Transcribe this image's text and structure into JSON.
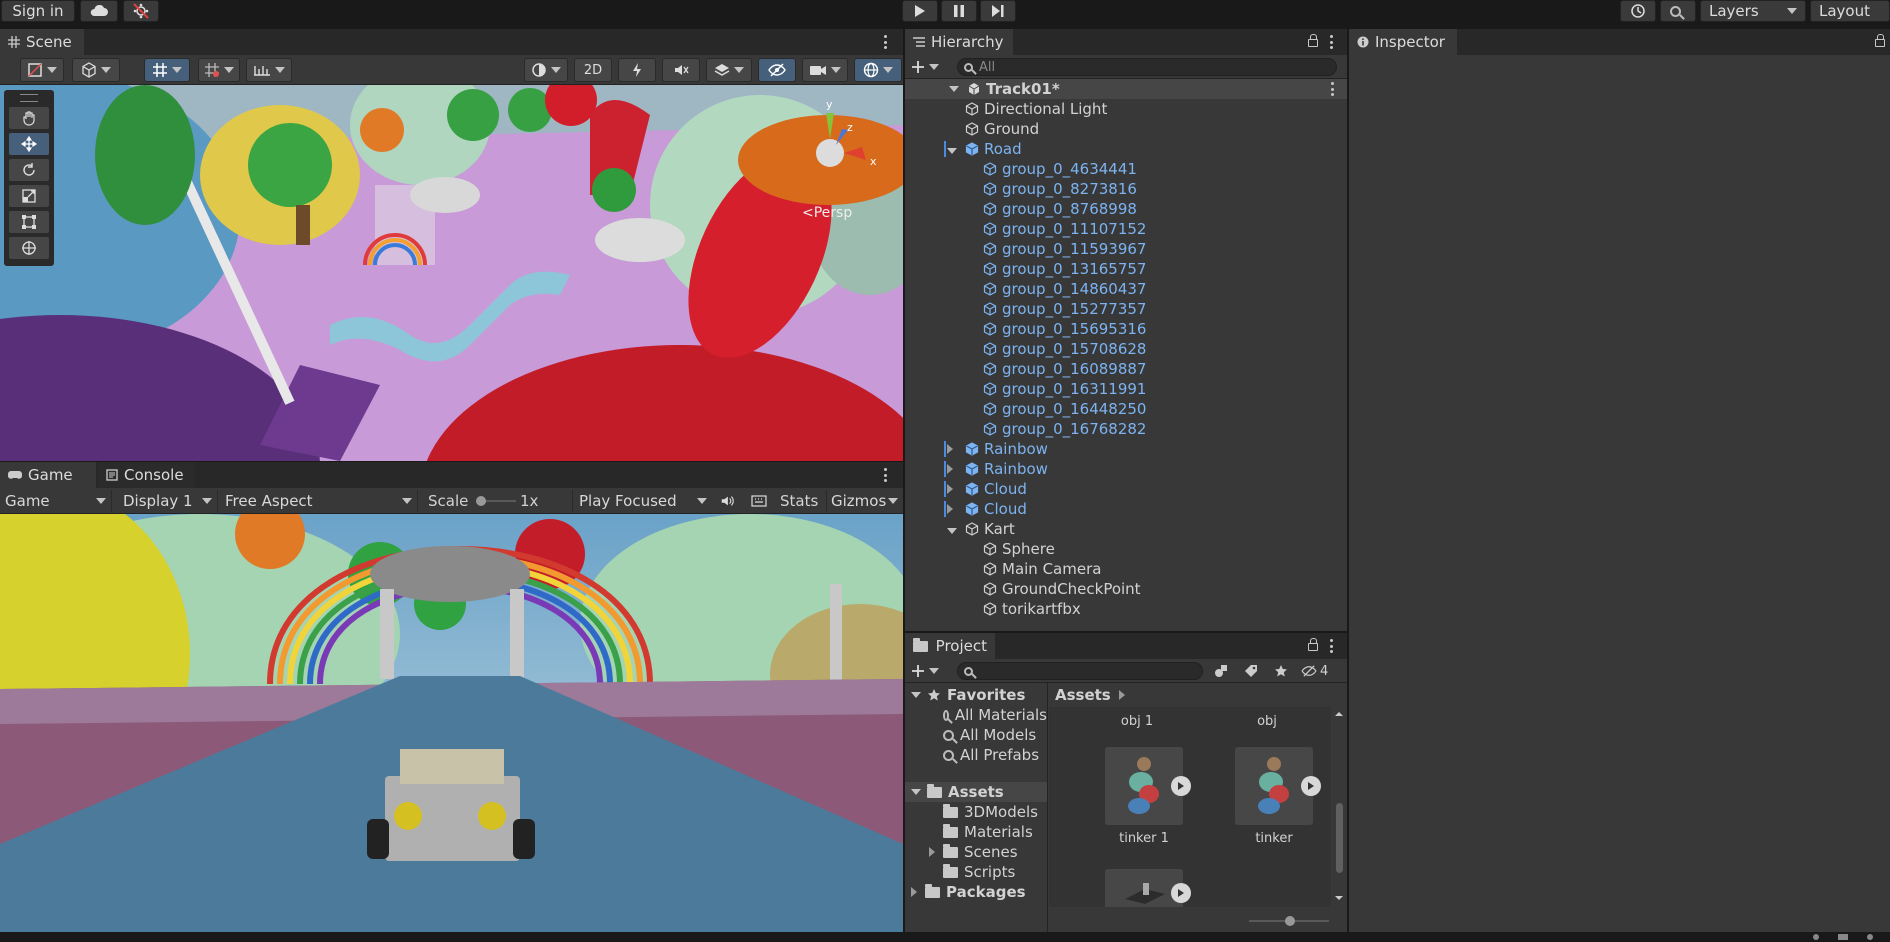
{
  "topbar": {
    "sign_in": "Sign in",
    "layers": "Layers",
    "layout": "Layout"
  },
  "scene": {
    "tab": "Scene",
    "mode_2d": "2D",
    "persp": "Persp",
    "gizmo_y": "y",
    "gizmo_z": "z",
    "gizmo_x": "x"
  },
  "game": {
    "tab_game": "Game",
    "tab_console": "Console",
    "view_select": "Game",
    "display": "Display 1",
    "aspect": "Free Aspect",
    "scale_label": "Scale",
    "scale_value": "1x",
    "play_mode": "Play Focused",
    "stats": "Stats",
    "gizmos": "Gizmos",
    "slider_value": 0
  },
  "hierarchy": {
    "tab": "Hierarchy",
    "search_placeholder": "All",
    "scene_name": "Track01*",
    "items": [
      {
        "label": "Directional Light"
      },
      {
        "label": "Ground"
      },
      {
        "label": "Road"
      },
      {
        "label": "group_0_4634441"
      },
      {
        "label": "group_0_8273816"
      },
      {
        "label": "group_0_8768998"
      },
      {
        "label": "group_0_11107152"
      },
      {
        "label": "group_0_11593967"
      },
      {
        "label": "group_0_13165757"
      },
      {
        "label": "group_0_14860437"
      },
      {
        "label": "group_0_15277357"
      },
      {
        "label": "group_0_15695316"
      },
      {
        "label": "group_0_15708628"
      },
      {
        "label": "group_0_16089887"
      },
      {
        "label": "group_0_16311991"
      },
      {
        "label": "group_0_16448250"
      },
      {
        "label": "group_0_16768282"
      },
      {
        "label": "Rainbow"
      },
      {
        "label": "Rainbow"
      },
      {
        "label": "Cloud"
      },
      {
        "label": "Cloud"
      },
      {
        "label": "Kart"
      },
      {
        "label": "Sphere"
      },
      {
        "label": "Main Camera"
      },
      {
        "label": "GroundCheckPoint"
      },
      {
        "label": "torikartfbx"
      }
    ]
  },
  "inspector": {
    "tab": "Inspector"
  },
  "project": {
    "tab": "Project",
    "hidden_count": "4",
    "favorites": "Favorites",
    "fav_items": [
      "All Materials",
      "All Models",
      "All Prefabs"
    ],
    "assets": "Assets",
    "asset_folders": [
      "3DModels",
      "Materials",
      "Scenes",
      "Scripts"
    ],
    "packages": "Packages",
    "breadcrumb": "Assets",
    "grid_top_labels": [
      "obj 1",
      "obj"
    ],
    "grid_items": [
      "tinker 1",
      "tinker"
    ]
  },
  "colors": {
    "accent_blue": "#46607c",
    "prefab_blue": "#7cb3f0",
    "panel": "#383838",
    "background": "#191919"
  }
}
